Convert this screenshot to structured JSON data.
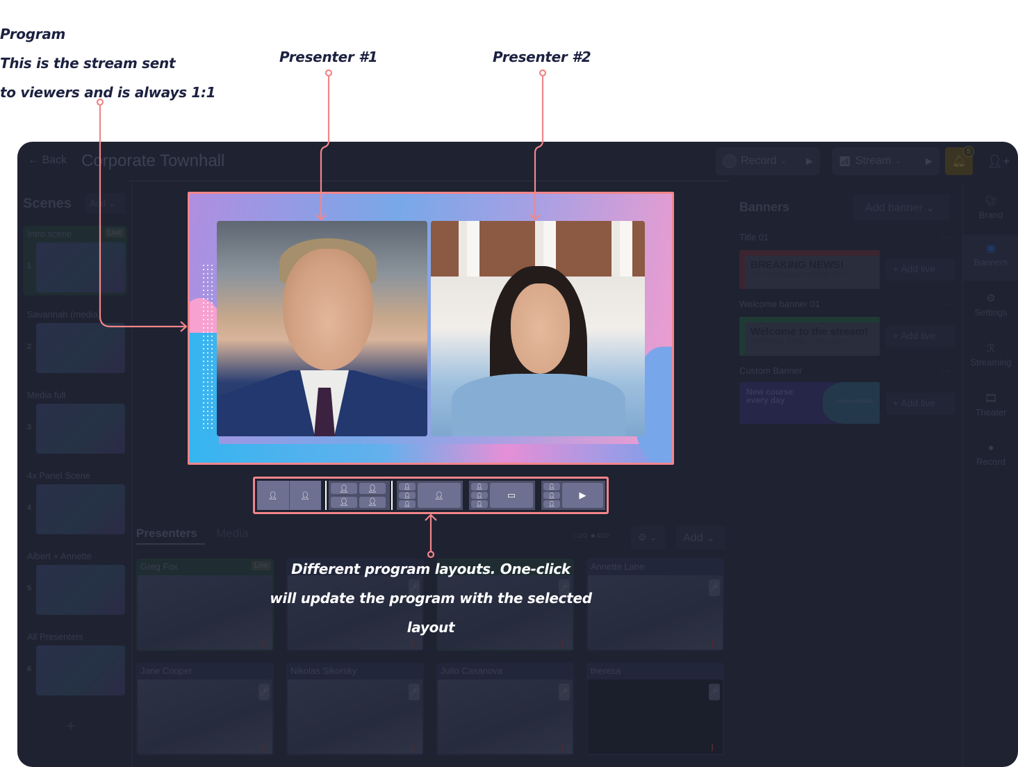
{
  "annotations": {
    "program_title": "Program",
    "program_line1": "This is the stream sent",
    "program_line2": "to viewers and is always 1:1",
    "presenter1": "Presenter #1",
    "presenter2": "Presenter #2",
    "layouts_line1": "Different program layouts.  One-click",
    "layouts_line2": "will update the program with the selected layout",
    "accent_color": "#f2868a"
  },
  "topbar": {
    "back_label": "Back",
    "title": "Corporate Townhall",
    "record_label": "Record",
    "stream_label": "Stream",
    "notification_count": "5"
  },
  "scenes": {
    "title": "Scenes",
    "add_label": "Add",
    "items": [
      {
        "number": "1",
        "name": "Intro scene",
        "badge": "Live"
      },
      {
        "number": "2",
        "name": "Savannah (media)"
      },
      {
        "number": "3",
        "name": "Media full"
      },
      {
        "number": "4",
        "name": "4x Panel Scene"
      },
      {
        "number": "5",
        "name": "Albert + Annette"
      },
      {
        "number": "6",
        "name": "All Presenters"
      }
    ],
    "add_scene_icon": "+"
  },
  "presenters": {
    "tabs": [
      "Presenters",
      "Media"
    ],
    "screen_count": "2/2",
    "camera_count": "4/10",
    "add_label": "Add",
    "cards": [
      {
        "name": "Greg Fox",
        "badge": "Live"
      },
      {
        "name": ""
      },
      {
        "name": ""
      },
      {
        "name": "Annette Lane"
      },
      {
        "name": "Jane Cooper"
      },
      {
        "name": "Nikolas Sikorsky"
      },
      {
        "name": "Julio Casanova"
      },
      {
        "name": "theresa"
      }
    ]
  },
  "layouts": [
    {
      "name": "side-by-side-2"
    },
    {
      "name": "grid-4"
    },
    {
      "name": "sidebar-3-plus-presenter"
    },
    {
      "name": "sidebar-3-plus-screen"
    },
    {
      "name": "sidebar-3-plus-media"
    }
  ],
  "banners": {
    "title": "Banners",
    "add_label": "Add banner",
    "items": [
      {
        "label": "Title 01",
        "headline": "BREAKING NEWS!",
        "sub": "SNN Investigation reveals that n...",
        "accent": "#5a2630",
        "action": "Add live"
      },
      {
        "label": "Welcome banner 01",
        "headline": "Welcome to the stream!",
        "sub": "We'll begin shortly.  Follow us on T",
        "accent": "#1f4038",
        "action": "Add live"
      },
      {
        "label": "Custom Banner",
        "headline": "New course every day",
        "sub": "www.website",
        "action": "Add live"
      }
    ]
  },
  "rail": {
    "items": [
      "Brand",
      "Banners",
      "Settings",
      "Streaming",
      "Theater",
      "Record"
    ]
  }
}
